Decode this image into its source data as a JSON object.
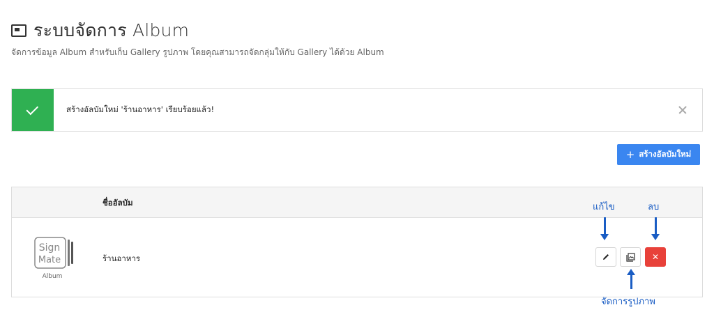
{
  "header": {
    "title": "ระบบจัดการ Album",
    "subtitle": "จัดการข้อมูล Album สำหรับเก็บ Gallery รูปภาพ โดยคุณสามารถจัดกลุ่มให้กับ Gallery ได้ด้วย Album"
  },
  "alert": {
    "message": "สร้างอัลบัมใหม่ 'ร้านอาหาร' เรียบร้อยแล้ว!",
    "status_color": "#2fb052"
  },
  "toolbar": {
    "add_label": "สร้างอัลบัมใหม่",
    "add_color": "#3a86f0"
  },
  "table": {
    "columns": [
      "ชื่ออัลบัม"
    ],
    "rows": [
      {
        "cover": {
          "brand_line1": "Sign",
          "brand_line2": "Mate",
          "caption": "Album"
        },
        "name": "ร้านอาหาร"
      }
    ]
  },
  "annotations": {
    "edit": "แก้ไข",
    "delete": "ลบ",
    "manage_images": "จัดการรูปภาพ"
  },
  "icons": {
    "title": "window-icon",
    "alert": "check-icon",
    "close": "close-icon",
    "edit": "pencil-icon",
    "images": "gallery-icon",
    "delete": "x-icon"
  }
}
